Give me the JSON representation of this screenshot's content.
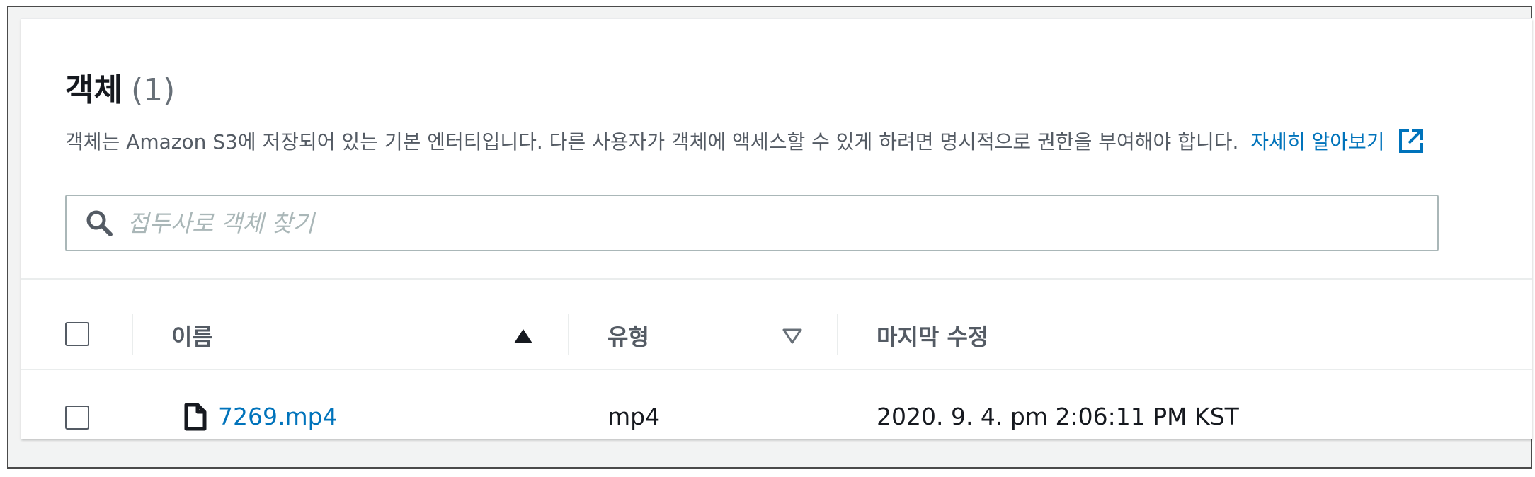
{
  "header": {
    "title": "객체",
    "count": "(1)",
    "description": "객체는 Amazon S3에 저장되어 있는 기본 엔터티입니다. 다른 사용자가 객체에 액세스할 수 있게 하려면 명시적으로 권한을 부여해야 합니다.",
    "learn_more": "자세히 알아보기",
    "learn_more_icon": "external-link-icon"
  },
  "search": {
    "placeholder": "접두사로 객체 찾기",
    "value": "",
    "icon": "search-icon"
  },
  "table": {
    "columns": [
      {
        "label": "이름",
        "sort": "ascending",
        "sort_icon": "sort-ascending-icon"
      },
      {
        "label": "유형",
        "sort": "none",
        "sort_icon": "sort-descending-outline-icon"
      },
      {
        "label": "마지막 수정",
        "sort": "none"
      }
    ],
    "rows": [
      {
        "selected": false,
        "icon": "file-icon",
        "name": "7269.mp4",
        "type": "mp4",
        "last_modified": "2020. 9. 4. pm 2:06:11 PM KST"
      }
    ]
  },
  "colors": {
    "link": "#0073bb",
    "text": "#16191f",
    "muted": "#545b64",
    "border": "#aab7b8"
  }
}
